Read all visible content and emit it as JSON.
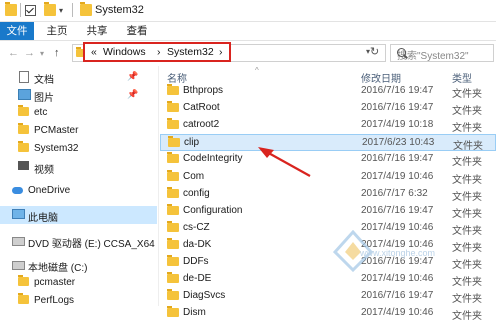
{
  "window": {
    "title": "System32"
  },
  "ribbon": {
    "tabs": [
      "文件",
      "主页",
      "共享",
      "查看"
    ]
  },
  "address": {
    "crumbs": [
      "«",
      "Windows",
      "›",
      "System32",
      "›"
    ]
  },
  "search": {
    "placeholder": "搜索\"System32\""
  },
  "nav": {
    "items": [
      {
        "label": "文档",
        "icon": "document-icon",
        "pinned": true
      },
      {
        "label": "图片",
        "icon": "picture-icon",
        "pinned": true
      },
      {
        "label": "etc",
        "icon": "folder-icon"
      },
      {
        "label": "PCMaster",
        "icon": "folder-icon"
      },
      {
        "label": "System32",
        "icon": "folder-icon"
      },
      {
        "label": "视频",
        "icon": "video-icon"
      },
      {
        "label": "OneDrive",
        "icon": "cloud-icon"
      },
      {
        "label": "此电脑",
        "icon": "computer-icon",
        "selected": true
      },
      {
        "label": "DVD 驱动器 (E:) CCSA_X64",
        "icon": "dvd-drive-icon"
      },
      {
        "label": "本地磁盘 (C:)",
        "icon": "drive-icon"
      },
      {
        "label": "pcmaster",
        "icon": "folder-icon"
      },
      {
        "label": "PerfLogs",
        "icon": "folder-icon"
      }
    ]
  },
  "columns": {
    "name": "名称",
    "date": "修改日期",
    "type": "类型"
  },
  "files": [
    {
      "name": "Bthprops",
      "date": "2016/7/16 19:47",
      "type": "文件夹"
    },
    {
      "name": "CatRoot",
      "date": "2016/7/16 19:47",
      "type": "文件夹"
    },
    {
      "name": "catroot2",
      "date": "2017/4/19 10:18",
      "type": "文件夹"
    },
    {
      "name": "clip",
      "date": "2017/6/23 10:43",
      "type": "文件夹",
      "selected": true
    },
    {
      "name": "CodeIntegrity",
      "date": "2016/7/16 19:47",
      "type": "文件夹"
    },
    {
      "name": "Com",
      "date": "2017/4/19 10:46",
      "type": "文件夹"
    },
    {
      "name": "config",
      "date": "2016/7/17 6:32",
      "type": "文件夹"
    },
    {
      "name": "Configuration",
      "date": "2016/7/16 19:47",
      "type": "文件夹"
    },
    {
      "name": "cs-CZ",
      "date": "2017/4/19 10:46",
      "type": "文件夹"
    },
    {
      "name": "da-DK",
      "date": "2017/4/19 10:46",
      "type": "文件夹"
    },
    {
      "name": "DDFs",
      "date": "2016/7/16 19:47",
      "type": "文件夹"
    },
    {
      "name": "de-DE",
      "date": "2017/4/19 10:46",
      "type": "文件夹"
    },
    {
      "name": "DiagSvcs",
      "date": "2016/7/16 19:47",
      "type": "文件夹"
    },
    {
      "name": "Dism",
      "date": "2017/4/19 10:46",
      "type": "文件夹"
    }
  ],
  "watermark": {
    "text": "www.xitonghe.com"
  },
  "colors": {
    "accent": "#1979ca",
    "highlight": "#d9241f",
    "folder": "#f5c33b"
  }
}
